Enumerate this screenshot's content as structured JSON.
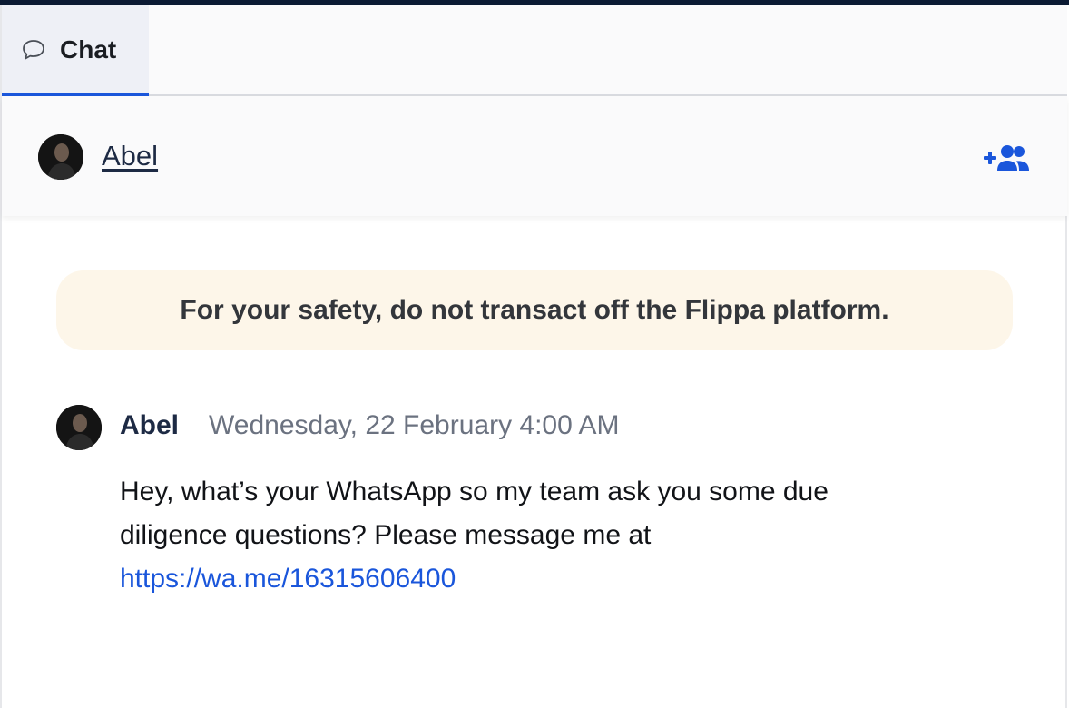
{
  "tab": {
    "label": "Chat",
    "icon": "chat-bubble-icon"
  },
  "header": {
    "contact_name": "Abel",
    "add_user_icon": "add-user-icon"
  },
  "safety_banner": {
    "text": "For your safety, do not transact off the Flippa platform."
  },
  "message": {
    "author": "Abel",
    "timestamp": "Wednesday, 22 February 4:00 AM",
    "text": "Hey, what’s your WhatsApp so my team ask you some due diligence questions? Please message me at",
    "link": "https://wa.me/16315606400"
  },
  "colors": {
    "accent": "#1a56db",
    "top_bar": "#0b1a33",
    "banner_background": "#fdf6e9",
    "name_color": "#1d2a44",
    "timestamp_color": "#6b7280"
  }
}
